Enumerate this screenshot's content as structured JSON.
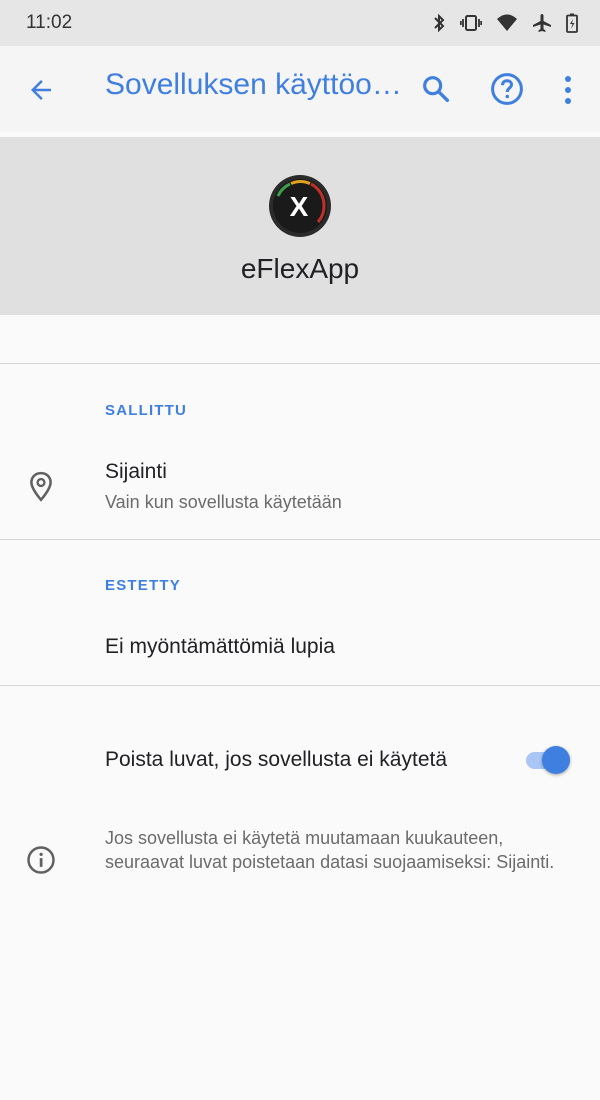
{
  "status_bar": {
    "time": "11:02",
    "icons": [
      "bluetooth-icon",
      "vibrate-icon",
      "wifi-icon",
      "airplane-icon",
      "battery-icon"
    ]
  },
  "app_bar": {
    "title": "Sovelluksen käyttöo…",
    "back_icon": "arrow-back-icon",
    "search_icon": "search-icon",
    "help_icon": "help-icon",
    "more_icon": "more-vert-icon"
  },
  "app": {
    "name": "eFlexApp",
    "logo_letter": "X"
  },
  "sections": {
    "allowed": {
      "header": "SALLITTU",
      "items": [
        {
          "title": "Sijainti",
          "subtitle": "Vain kun sovellusta käytetään",
          "icon": "location-pin-icon"
        }
      ]
    },
    "denied": {
      "header": "ESTETTY",
      "empty_text": "Ei myöntämättömiä lupia"
    }
  },
  "auto_revoke": {
    "label": "Poista luvat, jos sovellusta ei käytetä",
    "enabled": true
  },
  "info": {
    "icon": "info-icon",
    "text": "Jos sovellusta ei käytetä muutamaan kuukauteen, seuraavat luvat poistetaan datasi suojaamiseksi: Sijainti."
  },
  "colors": {
    "accent": "#3f7fe0",
    "header_bg": "#e0e0e0",
    "background": "#fafafa"
  }
}
